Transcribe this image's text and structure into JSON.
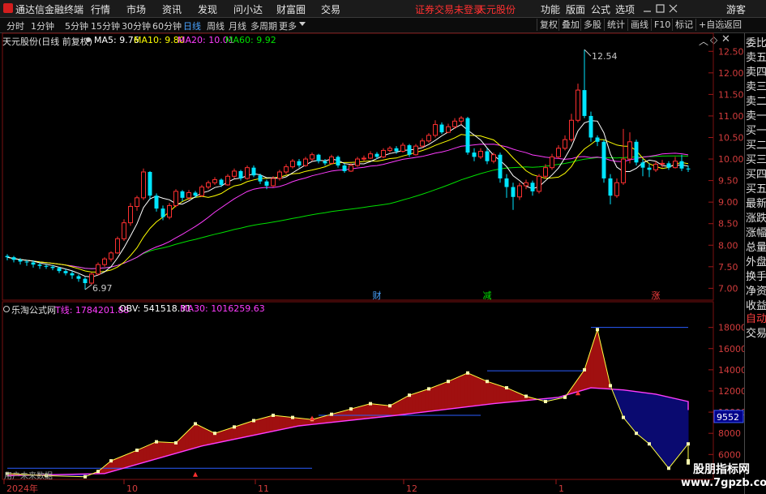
{
  "menubar": {
    "app_title": "通达信金融终端",
    "items": [
      "行情",
      "市场",
      "资讯",
      "发现",
      "问小达",
      "财富圈",
      "交易"
    ],
    "warning": "证券交易未登录",
    "stock": "天元股份",
    "right_items": [
      "功能",
      "版面",
      "公式",
      "选项"
    ],
    "user": "游客"
  },
  "toolbar": {
    "periods": [
      "分时",
      "1分钟",
      "5分钟",
      "15分钟",
      "30分钟",
      "60分钟",
      "日线",
      "周线",
      "月线",
      "多周期",
      "更多"
    ],
    "active_period": "日线",
    "right_buttons": [
      "复权",
      "叠加",
      "多股",
      "统计",
      "画线",
      "F10",
      "标记",
      "+自选",
      "返回"
    ]
  },
  "main_chart": {
    "title": "天元股份(日线 前复权)",
    "ma5": "MA5: 9.76",
    "ma10": "MA10: 9.80",
    "ma20": "MA20: 10.01",
    "ma60": "MA60: 9.92",
    "high_label": "12.54",
    "low_label": "6.97",
    "event_labels": [
      "财",
      "减",
      "涨"
    ],
    "colors": {
      "up": "#ff3030",
      "down": "#00e5ff",
      "ma5": "#ffffff",
      "ma10": "#ffff00",
      "ma20": "#ff3cff",
      "ma60": "#00e000"
    }
  },
  "sub_chart": {
    "title": "乐淘公式网",
    "t_line": "T线: 1784201.88",
    "obv": "OBV: 541518.31",
    "ma30": "MA30: 1016259.63",
    "current_value": "9552",
    "watermark_left": "用户未来数据"
  },
  "x_axis": [
    "2024年",
    "10",
    "11",
    "12",
    "1"
  ],
  "side_panel": [
    "委比",
    "卖五",
    "卖四",
    "卖三",
    "卖二",
    "卖一",
    "买一",
    "买二",
    "买三",
    "买四",
    "买五",
    "最新",
    "涨跌",
    "涨幅",
    "总量",
    "外盘",
    "换手",
    "净资",
    "收益",
    "自动",
    "交易"
  ],
  "watermark": {
    "line1": "股朋指标网",
    "line2": "www.7gpzb.com"
  },
  "chart_data": [
    {
      "type": "candlestick",
      "title": "天元股份(日线 前复权)",
      "ylim": [
        6.8,
        12.75
      ],
      "yticks": [
        7.0,
        7.5,
        8.0,
        8.5,
        9.0,
        9.5,
        10.0,
        10.5,
        11.0,
        11.5,
        12.0,
        12.5
      ],
      "xticks": [
        "2024年",
        "10",
        "11",
        "12",
        "1"
      ],
      "candles": [
        [
          7.75,
          7.72,
          7.79,
          7.65
        ],
        [
          7.72,
          7.66,
          7.75,
          7.6
        ],
        [
          7.66,
          7.62,
          7.7,
          7.55
        ],
        [
          7.62,
          7.6,
          7.66,
          7.52
        ],
        [
          7.6,
          7.55,
          7.65,
          7.48
        ],
        [
          7.55,
          7.52,
          7.6,
          7.45
        ],
        [
          7.52,
          7.5,
          7.56,
          7.45
        ],
        [
          7.5,
          7.47,
          7.54,
          7.42
        ],
        [
          7.47,
          7.4,
          7.5,
          7.35
        ],
        [
          7.4,
          7.35,
          7.45,
          7.3
        ],
        [
          7.35,
          7.3,
          7.4,
          7.22
        ],
        [
          7.28,
          7.22,
          7.32,
          7.15
        ],
        [
          7.22,
          7.12,
          7.26,
          6.97
        ],
        [
          7.12,
          7.33,
          7.36,
          7.08
        ],
        [
          7.33,
          7.55,
          7.6,
          7.3
        ],
        [
          7.55,
          7.68,
          7.72,
          7.5
        ],
        [
          7.68,
          7.82,
          7.86,
          7.62
        ],
        [
          7.82,
          8.15,
          8.2,
          7.8
        ],
        [
          8.15,
          8.52,
          8.6,
          8.1
        ],
        [
          8.52,
          8.9,
          8.98,
          8.45
        ],
        [
          8.9,
          9.1,
          9.15,
          8.8
        ],
        [
          9.1,
          9.7,
          9.78,
          9.05
        ],
        [
          9.7,
          9.15,
          9.72,
          9.05
        ],
        [
          9.15,
          8.85,
          9.2,
          8.78
        ],
        [
          8.85,
          8.65,
          8.92,
          8.58
        ],
        [
          8.65,
          8.92,
          8.98,
          8.6
        ],
        [
          8.92,
          9.25,
          9.3,
          8.88
        ],
        [
          9.25,
          9.1,
          9.28,
          9.02
        ],
        [
          9.1,
          9.22,
          9.28,
          9.05
        ],
        [
          9.22,
          9.15,
          9.26,
          9.1
        ],
        [
          9.15,
          9.35,
          9.4,
          9.12
        ],
        [
          9.35,
          9.45,
          9.5,
          9.3
        ],
        [
          9.45,
          9.52,
          9.58,
          9.4
        ],
        [
          9.52,
          9.4,
          9.55,
          9.35
        ],
        [
          9.4,
          9.6,
          9.65,
          9.38
        ],
        [
          9.6,
          9.72,
          9.78,
          9.55
        ],
        [
          9.72,
          9.55,
          9.75,
          9.5
        ],
        [
          9.55,
          9.8,
          9.85,
          9.52
        ],
        [
          9.8,
          9.62,
          9.85,
          9.58
        ],
        [
          9.62,
          9.48,
          9.66,
          9.42
        ],
        [
          9.48,
          9.38,
          9.52,
          9.3
        ],
        [
          9.38,
          9.55,
          9.6,
          9.35
        ],
        [
          9.55,
          9.7,
          9.75,
          9.5
        ],
        [
          9.7,
          9.82,
          9.88,
          9.65
        ],
        [
          9.82,
          9.95,
          10.0,
          9.78
        ],
        [
          9.95,
          9.85,
          10.0,
          9.8
        ],
        [
          9.85,
          10.0,
          10.05,
          9.82
        ],
        [
          10.0,
          10.1,
          10.15,
          9.95
        ],
        [
          10.1,
          9.95,
          10.12,
          9.9
        ],
        [
          9.95,
          9.9,
          10.0,
          9.85
        ],
        [
          9.9,
          10.05,
          10.1,
          9.88
        ],
        [
          10.05,
          9.85,
          10.08,
          9.8
        ],
        [
          9.85,
          9.72,
          9.9,
          9.68
        ],
        [
          9.72,
          9.85,
          9.9,
          9.7
        ],
        [
          9.85,
          10.0,
          10.05,
          9.82
        ],
        [
          10.0,
          10.02,
          10.08,
          9.96
        ],
        [
          10.02,
          10.12,
          10.18,
          10.0
        ],
        [
          10.12,
          10.05,
          10.16,
          10.0
        ],
        [
          10.05,
          10.2,
          10.25,
          10.02
        ],
        [
          10.2,
          10.25,
          10.3,
          10.15
        ],
        [
          10.25,
          10.18,
          10.3,
          10.12
        ],
        [
          10.18,
          10.32,
          10.38,
          10.15
        ],
        [
          10.32,
          10.1,
          10.35,
          10.05
        ],
        [
          10.1,
          10.3,
          10.35,
          10.08
        ],
        [
          10.3,
          10.42,
          10.48,
          10.26
        ],
        [
          10.42,
          10.55,
          10.6,
          10.38
        ],
        [
          10.55,
          10.8,
          10.9,
          10.5
        ],
        [
          10.8,
          10.62,
          10.85,
          10.58
        ],
        [
          10.62,
          10.75,
          10.82,
          10.6
        ],
        [
          10.75,
          10.88,
          10.95,
          10.7
        ],
        [
          10.88,
          10.95,
          11.0,
          10.8
        ],
        [
          10.95,
          10.15,
          10.98,
          10.1
        ],
        [
          10.15,
          10.05,
          10.25,
          9.95
        ],
        [
          10.05,
          10.18,
          10.25,
          10.0
        ],
        [
          10.18,
          9.95,
          10.25,
          9.88
        ],
        [
          9.95,
          10.1,
          10.15,
          9.9
        ],
        [
          10.1,
          9.55,
          10.15,
          9.45
        ],
        [
          9.55,
          9.35,
          9.65,
          9.1
        ],
        [
          9.35,
          9.12,
          9.45,
          8.82
        ],
        [
          9.12,
          9.38,
          9.45,
          9.05
        ],
        [
          9.38,
          9.45,
          9.52,
          9.3
        ],
        [
          9.45,
          9.25,
          9.5,
          9.15
        ],
        [
          9.25,
          9.6,
          9.65,
          9.2
        ],
        [
          9.6,
          9.8,
          9.88,
          9.55
        ],
        [
          9.8,
          10.05,
          10.12,
          9.75
        ],
        [
          10.05,
          10.25,
          10.32,
          10.0
        ],
        [
          10.25,
          10.45,
          10.55,
          10.2
        ],
        [
          10.45,
          10.9,
          11.05,
          10.4
        ],
        [
          10.9,
          11.6,
          11.75,
          10.85
        ],
        [
          11.6,
          11.0,
          12.54,
          10.95
        ],
        [
          11.0,
          10.5,
          11.1,
          10.4
        ],
        [
          10.5,
          10.4,
          10.55,
          10.3
        ],
        [
          10.4,
          9.55,
          10.45,
          9.45
        ],
        [
          9.55,
          9.15,
          9.65,
          8.95
        ],
        [
          9.15,
          9.45,
          9.55,
          9.1
        ],
        [
          9.45,
          10.0,
          10.7,
          9.4
        ],
        [
          10.0,
          10.4,
          10.62,
          9.9
        ],
        [
          10.4,
          9.92,
          10.45,
          9.85
        ],
        [
          9.92,
          9.8,
          10.0,
          9.6
        ],
        [
          9.8,
          9.75,
          9.9,
          9.58
        ],
        [
          9.75,
          9.88,
          9.95,
          9.7
        ],
        [
          9.88,
          9.9,
          9.98,
          9.8
        ],
        [
          9.9,
          9.8,
          9.95,
          9.75
        ],
        [
          9.8,
          9.95,
          10.05,
          9.78
        ],
        [
          9.95,
          9.78,
          10.1,
          9.72
        ],
        [
          9.78,
          9.76,
          9.85,
          9.7
        ]
      ]
    },
    {
      "type": "area",
      "title": "乐淘公式网",
      "ylim": [
        3800,
        19200
      ],
      "yticks": [
        6000,
        8000,
        10000,
        12000,
        14000,
        16000,
        18000
      ],
      "series": [
        {
          "name": "T线",
          "x": [
            0,
            6,
            12,
            14,
            16,
            20,
            23,
            26,
            29,
            32,
            35,
            38,
            41,
            44,
            47,
            50,
            53,
            56,
            59,
            62,
            65,
            68,
            71,
            74,
            77,
            80,
            83,
            86,
            89,
            91,
            93,
            95,
            97,
            99,
            102,
            105,
            107,
            110
          ],
          "values": [
            4200,
            4000,
            3900,
            4400,
            5400,
            6400,
            7200,
            7100,
            8900,
            8000,
            8600,
            9200,
            9700,
            9500,
            9300,
            9800,
            10300,
            10800,
            10600,
            11600,
            12200,
            12900,
            13700,
            12900,
            12300,
            11500,
            11000,
            11400,
            14000,
            17800,
            12500,
            9500,
            8000,
            7000,
            4700,
            7000,
            5200,
            5400
          ]
        },
        {
          "name": "OBV",
          "x": [
            0,
            15,
            30,
            45,
            60,
            75,
            85,
            90,
            95,
            100,
            105,
            110
          ],
          "values": [
            4000,
            4200,
            6800,
            8700,
            9700,
            10800,
            11400,
            12300,
            12100,
            11700,
            11000,
            10200
          ]
        }
      ],
      "reference_lines": [
        {
          "from": 0,
          "to": 47,
          "value": 4700
        },
        {
          "from": 48,
          "to": 73,
          "value": 9700
        },
        {
          "from": 74,
          "to": 89,
          "value": 13900
        },
        {
          "from": 90,
          "to": 110,
          "value": 18000
        }
      ]
    }
  ]
}
